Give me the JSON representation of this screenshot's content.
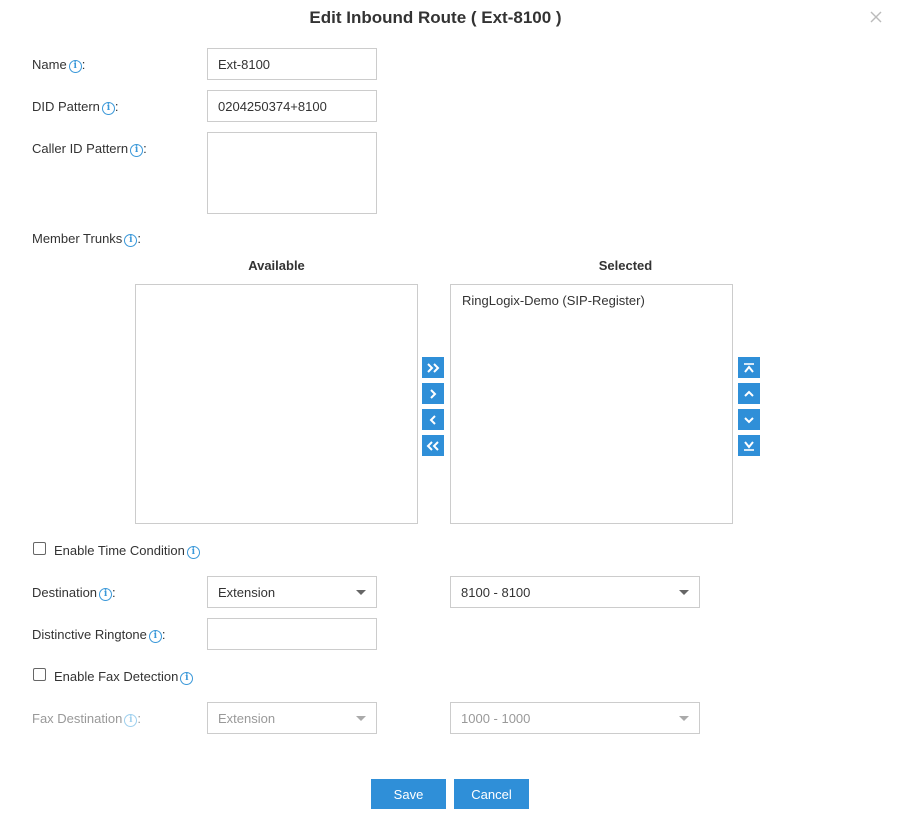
{
  "dialog": {
    "title": "Edit Inbound Route ( Ext-8100 )"
  },
  "fields": {
    "name": {
      "label": "Name",
      "value": "Ext-8100"
    },
    "did_pattern": {
      "label": "DID Pattern",
      "value": "0204250374+8100"
    },
    "caller_id_pattern": {
      "label": "Caller ID Pattern",
      "value": ""
    },
    "member_trunks": {
      "label": "Member Trunks"
    },
    "enable_time_condition": {
      "label": "Enable Time Condition",
      "checked": false
    },
    "destination": {
      "label": "Destination",
      "type_value": "Extension",
      "target_value": "8100 - 8100"
    },
    "distinctive_ringtone": {
      "label": "Distinctive Ringtone",
      "value": ""
    },
    "enable_fax_detection": {
      "label": "Enable Fax Detection",
      "checked": false
    },
    "fax_destination": {
      "label": "Fax Destination",
      "type_value": "Extension",
      "target_value": "1000 - 1000",
      "disabled": true
    }
  },
  "trunks": {
    "available_heading": "Available",
    "selected_heading": "Selected",
    "available_items": [],
    "selected_items": [
      "RingLogix-Demo (SIP-Register)"
    ]
  },
  "colon": ":",
  "buttons": {
    "save": "Save",
    "cancel": "Cancel"
  },
  "colors": {
    "accent": "#2f8fd8",
    "info": "#3a98d9"
  }
}
